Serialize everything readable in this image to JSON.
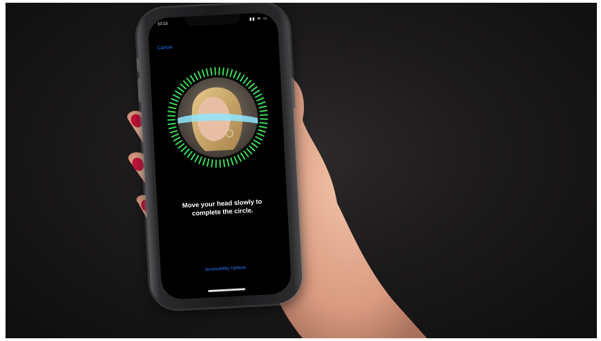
{
  "status_bar": {
    "time": "10:15",
    "icons": "▮▮ ≋ ▭"
  },
  "setup_screen": {
    "cancel_label": "Cancel",
    "instruction_line1": "Move your head slowly to",
    "instruction_line2": "complete the circle.",
    "accessibility_label": "Accessibility Options"
  },
  "colors": {
    "ring_active": "#3ddc5c",
    "scan_band": "#8ee6ff",
    "link_blue": "#1e7cff",
    "nail_polish": "#c8143c",
    "skin": "#e8b79c"
  },
  "icon_names": [
    "face-scan-ring-icon",
    "home-indicator-icon"
  ]
}
